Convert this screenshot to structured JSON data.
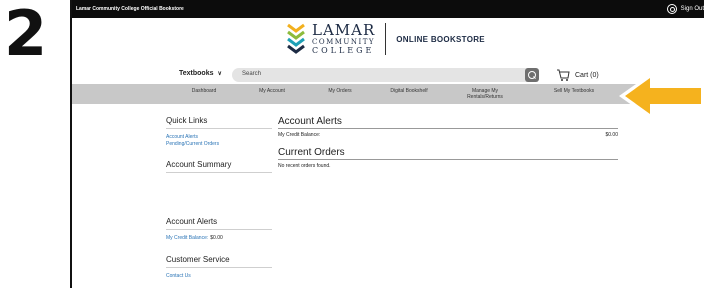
{
  "step_number": "2",
  "topbar": {
    "store_name": "Lamar Community College Official Bookstore",
    "signout_label": "Sign Out"
  },
  "logo": {
    "line1": "LAMAR",
    "line2": "COMMUNITY",
    "line3": "COLLEGE",
    "subtitle": "ONLINE BOOKSTORE"
  },
  "search": {
    "textbooks_label": "Textbooks",
    "placeholder": "Search",
    "cart_label": "Cart (0)"
  },
  "nav": {
    "items": [
      "Dashboard",
      "My Account",
      "My Orders",
      "Digital Bookshelf",
      "Manage My Rentals/Returns",
      "Sell My Textbooks"
    ]
  },
  "sidebar": {
    "quick_links_title": "Quick Links",
    "quick_links": [
      "Account Alerts",
      "Pending/Current Orders"
    ],
    "account_summary_title": "Account Summary",
    "account_alerts_title": "Account Alerts",
    "credit_label": "My Credit Balance:",
    "credit_value": "$0.00",
    "customer_service_title": "Customer Service",
    "contact_label": "Contact Us"
  },
  "main": {
    "alerts_title": "Account Alerts",
    "credit_label": "My Credit Balance:",
    "credit_value": "$0.00",
    "orders_title": "Current Orders",
    "orders_empty": "No recent orders found."
  },
  "colors": {
    "topbar": "#0c0c0c",
    "navbar": "#c8c8c8",
    "link": "#2a74b6",
    "arrow": "#f5b21e",
    "logo_navy": "#1d2b44",
    "logo_yellow": "#f2b01e",
    "logo_green": "#8dbb3c",
    "logo_teal": "#1ea0b6"
  }
}
